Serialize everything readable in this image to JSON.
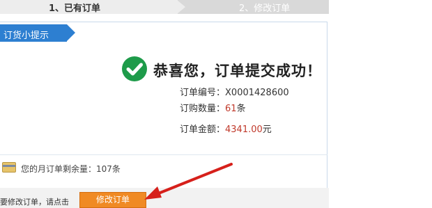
{
  "steps": {
    "step1": "1、已有订单",
    "step2": "2、修改订单"
  },
  "panel": {
    "tag": "订货小提示",
    "success_title": "恭喜您，订单提交成功！",
    "order_number_label": "订单编号：",
    "order_number": "X0001428600",
    "quantity_label": "订购数量：",
    "quantity_value": "61",
    "quantity_unit": "条",
    "amount_label": "订单金额：",
    "amount_value": "4341.00",
    "amount_unit": "元"
  },
  "remaining": {
    "text": "您的月订单剩余量：107条"
  },
  "modify": {
    "hint": "要修改订单，请点击",
    "button_label": "修改订单"
  },
  "colors": {
    "accent_blue": "#2d7fd1",
    "success_green": "#1e9b4a",
    "button_orange": "#f08a24",
    "value_red": "#c0392b",
    "arrow_red": "#d6201b"
  }
}
